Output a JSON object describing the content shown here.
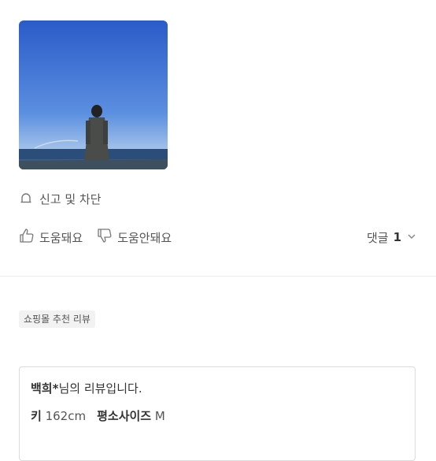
{
  "photo": {
    "alt_icon": "review-photo"
  },
  "report": {
    "label": "신고 및 차단",
    "icon": "bell-icon"
  },
  "actions": {
    "helpful_label": "도움돼요",
    "not_helpful_label": "도움안돼요",
    "comments_label": "댓글",
    "comments_count": "1"
  },
  "recommend_tag": "쇼핑몰 추천 리뷰",
  "review": {
    "user": "백희*",
    "title_suffix": "님의 리뷰입니다.",
    "height_label": "키",
    "height_value": "162cm",
    "size_label": "평소사이즈",
    "size_value": "M"
  }
}
